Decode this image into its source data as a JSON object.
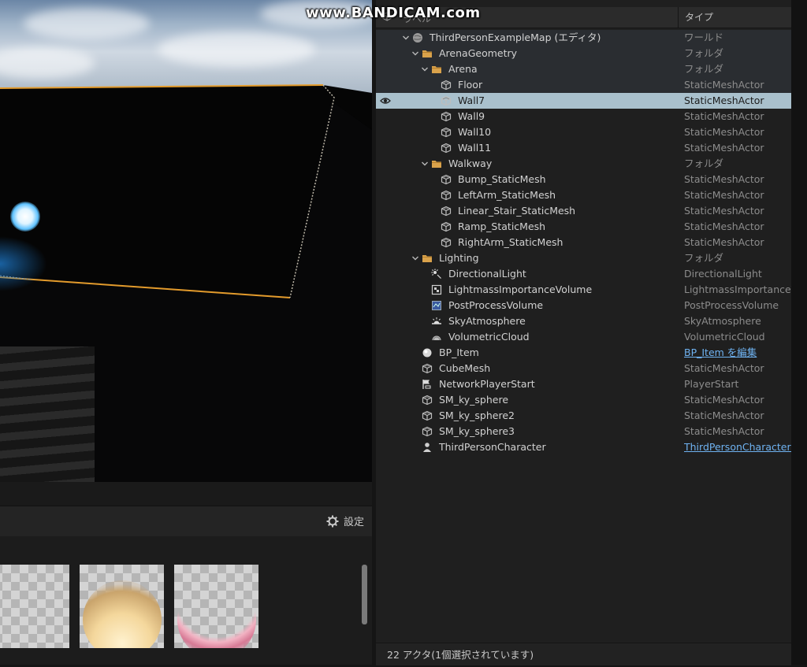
{
  "watermark": "www.BANDICAM.com",
  "outliner": {
    "header": {
      "label_col": "ラベル",
      "type_col": "タイプ"
    },
    "rows": [
      {
        "label": "ThirdPersonExampleMap (エディタ)",
        "type": "ワールド",
        "icon": "world-icon",
        "depth": 0,
        "chevron": true
      },
      {
        "label": "ArenaGeometry",
        "type": "フォルダ",
        "icon": "folder-icon",
        "depth": 1,
        "chevron": true
      },
      {
        "label": "Arena",
        "type": "フォルダ",
        "icon": "folder-icon",
        "depth": 2,
        "chevron": true
      },
      {
        "label": "Floor",
        "type": "StaticMeshActor",
        "icon": "static-mesh-icon",
        "depth": 3
      },
      {
        "label": "Wall7",
        "type": "StaticMeshActor",
        "icon": "static-mesh-icon",
        "depth": 3,
        "selected": true
      },
      {
        "label": "Wall9",
        "type": "StaticMeshActor",
        "icon": "static-mesh-icon",
        "depth": 3
      },
      {
        "label": "Wall10",
        "type": "StaticMeshActor",
        "icon": "static-mesh-icon",
        "depth": 3
      },
      {
        "label": "Wall11",
        "type": "StaticMeshActor",
        "icon": "static-mesh-icon",
        "depth": 3
      },
      {
        "label": "Walkway",
        "type": "フォルダ",
        "icon": "folder-icon",
        "depth": 2,
        "chevron": true
      },
      {
        "label": "Bump_StaticMesh",
        "type": "StaticMeshActor",
        "icon": "static-mesh-icon",
        "depth": 3
      },
      {
        "label": "LeftArm_StaticMesh",
        "type": "StaticMeshActor",
        "icon": "static-mesh-icon",
        "depth": 3
      },
      {
        "label": "Linear_Stair_StaticMesh",
        "type": "StaticMeshActor",
        "icon": "static-mesh-icon",
        "depth": 3
      },
      {
        "label": "Ramp_StaticMesh",
        "type": "StaticMeshActor",
        "icon": "static-mesh-icon",
        "depth": 3
      },
      {
        "label": "RightArm_StaticMesh",
        "type": "StaticMeshActor",
        "icon": "static-mesh-icon",
        "depth": 3
      },
      {
        "label": "Lighting",
        "type": "フォルダ",
        "icon": "folder-icon",
        "depth": 1,
        "chevron": true
      },
      {
        "label": "DirectionalLight",
        "type": "DirectionalLight",
        "icon": "directional-light-icon",
        "depth": 2
      },
      {
        "label": "LightmassImportanceVolume",
        "type": "LightmassImportanceVolume",
        "icon": "lightmass-volume-icon",
        "depth": 2
      },
      {
        "label": "PostProcessVolume",
        "type": "PostProcessVolume",
        "icon": "post-process-volume-icon",
        "depth": 2
      },
      {
        "label": "SkyAtmosphere",
        "type": "SkyAtmosphere",
        "icon": "sky-atmosphere-icon",
        "depth": 2
      },
      {
        "label": "VolumetricCloud",
        "type": "VolumetricCloud",
        "icon": "volumetric-cloud-icon",
        "depth": 2
      },
      {
        "label": "BP_Item",
        "type": "BP_Item を編集",
        "icon": "blueprint-sphere-icon",
        "depth": 1,
        "link": true
      },
      {
        "label": "CubeMesh",
        "type": "StaticMeshActor",
        "icon": "static-mesh-icon",
        "depth": 1
      },
      {
        "label": "NetworkPlayerStart",
        "type": "PlayerStart",
        "icon": "player-start-icon",
        "depth": 1
      },
      {
        "label": "SM_ky_sphere",
        "type": "StaticMeshActor",
        "icon": "static-mesh-icon",
        "depth": 1
      },
      {
        "label": "SM_ky_sphere2",
        "type": "StaticMeshActor",
        "icon": "static-mesh-icon",
        "depth": 1
      },
      {
        "label": "SM_ky_sphere3",
        "type": "StaticMeshActor",
        "icon": "static-mesh-icon",
        "depth": 1
      },
      {
        "label": "ThirdPersonCharacter",
        "type": "ThirdPersonCharacter を編集",
        "icon": "character-icon",
        "depth": 1,
        "link": true
      }
    ],
    "status": "22 アクタ(1個選択されています)"
  },
  "content_browser": {
    "settings_label": "設定",
    "thumbnails": [
      "material-thumbnail-plain",
      "material-thumbnail-warm",
      "material-thumbnail-pink"
    ]
  },
  "colors": {
    "selection": "#a9c0cc",
    "link": "#6fb3f2",
    "folder": "#d9a24b",
    "wall_outline": "#e39b2c"
  }
}
